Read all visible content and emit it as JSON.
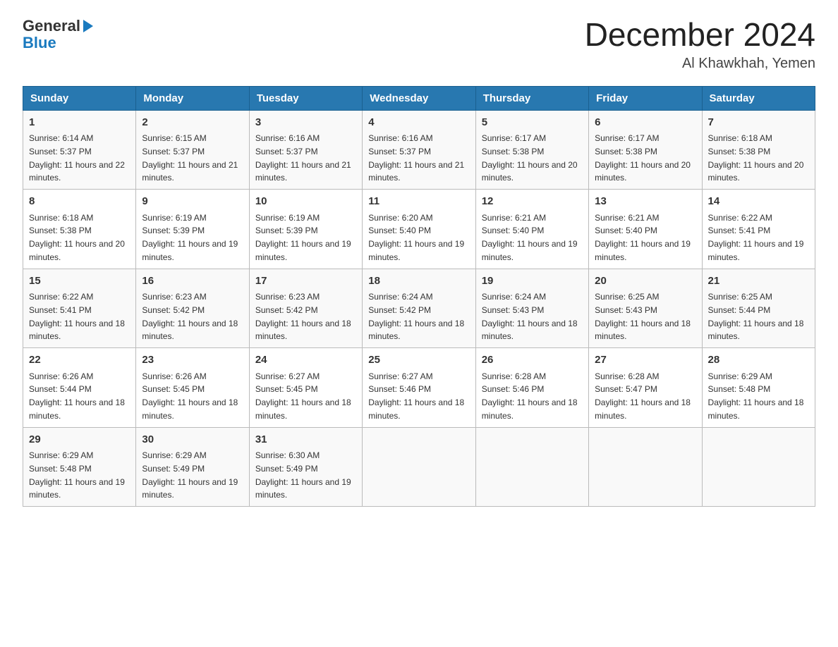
{
  "logo": {
    "text_general": "General",
    "text_blue": "Blue"
  },
  "title": "December 2024",
  "subtitle": "Al Khawkhah, Yemen",
  "weekdays": [
    "Sunday",
    "Monday",
    "Tuesday",
    "Wednesday",
    "Thursday",
    "Friday",
    "Saturday"
  ],
  "weeks": [
    [
      {
        "day": "1",
        "sunrise": "6:14 AM",
        "sunset": "5:37 PM",
        "daylight": "11 hours and 22 minutes."
      },
      {
        "day": "2",
        "sunrise": "6:15 AM",
        "sunset": "5:37 PM",
        "daylight": "11 hours and 21 minutes."
      },
      {
        "day": "3",
        "sunrise": "6:16 AM",
        "sunset": "5:37 PM",
        "daylight": "11 hours and 21 minutes."
      },
      {
        "day": "4",
        "sunrise": "6:16 AM",
        "sunset": "5:37 PM",
        "daylight": "11 hours and 21 minutes."
      },
      {
        "day": "5",
        "sunrise": "6:17 AM",
        "sunset": "5:38 PM",
        "daylight": "11 hours and 20 minutes."
      },
      {
        "day": "6",
        "sunrise": "6:17 AM",
        "sunset": "5:38 PM",
        "daylight": "11 hours and 20 minutes."
      },
      {
        "day": "7",
        "sunrise": "6:18 AM",
        "sunset": "5:38 PM",
        "daylight": "11 hours and 20 minutes."
      }
    ],
    [
      {
        "day": "8",
        "sunrise": "6:18 AM",
        "sunset": "5:38 PM",
        "daylight": "11 hours and 20 minutes."
      },
      {
        "day": "9",
        "sunrise": "6:19 AM",
        "sunset": "5:39 PM",
        "daylight": "11 hours and 19 minutes."
      },
      {
        "day": "10",
        "sunrise": "6:19 AM",
        "sunset": "5:39 PM",
        "daylight": "11 hours and 19 minutes."
      },
      {
        "day": "11",
        "sunrise": "6:20 AM",
        "sunset": "5:40 PM",
        "daylight": "11 hours and 19 minutes."
      },
      {
        "day": "12",
        "sunrise": "6:21 AM",
        "sunset": "5:40 PM",
        "daylight": "11 hours and 19 minutes."
      },
      {
        "day": "13",
        "sunrise": "6:21 AM",
        "sunset": "5:40 PM",
        "daylight": "11 hours and 19 minutes."
      },
      {
        "day": "14",
        "sunrise": "6:22 AM",
        "sunset": "5:41 PM",
        "daylight": "11 hours and 19 minutes."
      }
    ],
    [
      {
        "day": "15",
        "sunrise": "6:22 AM",
        "sunset": "5:41 PM",
        "daylight": "11 hours and 18 minutes."
      },
      {
        "day": "16",
        "sunrise": "6:23 AM",
        "sunset": "5:42 PM",
        "daylight": "11 hours and 18 minutes."
      },
      {
        "day": "17",
        "sunrise": "6:23 AM",
        "sunset": "5:42 PM",
        "daylight": "11 hours and 18 minutes."
      },
      {
        "day": "18",
        "sunrise": "6:24 AM",
        "sunset": "5:42 PM",
        "daylight": "11 hours and 18 minutes."
      },
      {
        "day": "19",
        "sunrise": "6:24 AM",
        "sunset": "5:43 PM",
        "daylight": "11 hours and 18 minutes."
      },
      {
        "day": "20",
        "sunrise": "6:25 AM",
        "sunset": "5:43 PM",
        "daylight": "11 hours and 18 minutes."
      },
      {
        "day": "21",
        "sunrise": "6:25 AM",
        "sunset": "5:44 PM",
        "daylight": "11 hours and 18 minutes."
      }
    ],
    [
      {
        "day": "22",
        "sunrise": "6:26 AM",
        "sunset": "5:44 PM",
        "daylight": "11 hours and 18 minutes."
      },
      {
        "day": "23",
        "sunrise": "6:26 AM",
        "sunset": "5:45 PM",
        "daylight": "11 hours and 18 minutes."
      },
      {
        "day": "24",
        "sunrise": "6:27 AM",
        "sunset": "5:45 PM",
        "daylight": "11 hours and 18 minutes."
      },
      {
        "day": "25",
        "sunrise": "6:27 AM",
        "sunset": "5:46 PM",
        "daylight": "11 hours and 18 minutes."
      },
      {
        "day": "26",
        "sunrise": "6:28 AM",
        "sunset": "5:46 PM",
        "daylight": "11 hours and 18 minutes."
      },
      {
        "day": "27",
        "sunrise": "6:28 AM",
        "sunset": "5:47 PM",
        "daylight": "11 hours and 18 minutes."
      },
      {
        "day": "28",
        "sunrise": "6:29 AM",
        "sunset": "5:48 PM",
        "daylight": "11 hours and 18 minutes."
      }
    ],
    [
      {
        "day": "29",
        "sunrise": "6:29 AM",
        "sunset": "5:48 PM",
        "daylight": "11 hours and 19 minutes."
      },
      {
        "day": "30",
        "sunrise": "6:29 AM",
        "sunset": "5:49 PM",
        "daylight": "11 hours and 19 minutes."
      },
      {
        "day": "31",
        "sunrise": "6:30 AM",
        "sunset": "5:49 PM",
        "daylight": "11 hours and 19 minutes."
      },
      null,
      null,
      null,
      null
    ]
  ]
}
